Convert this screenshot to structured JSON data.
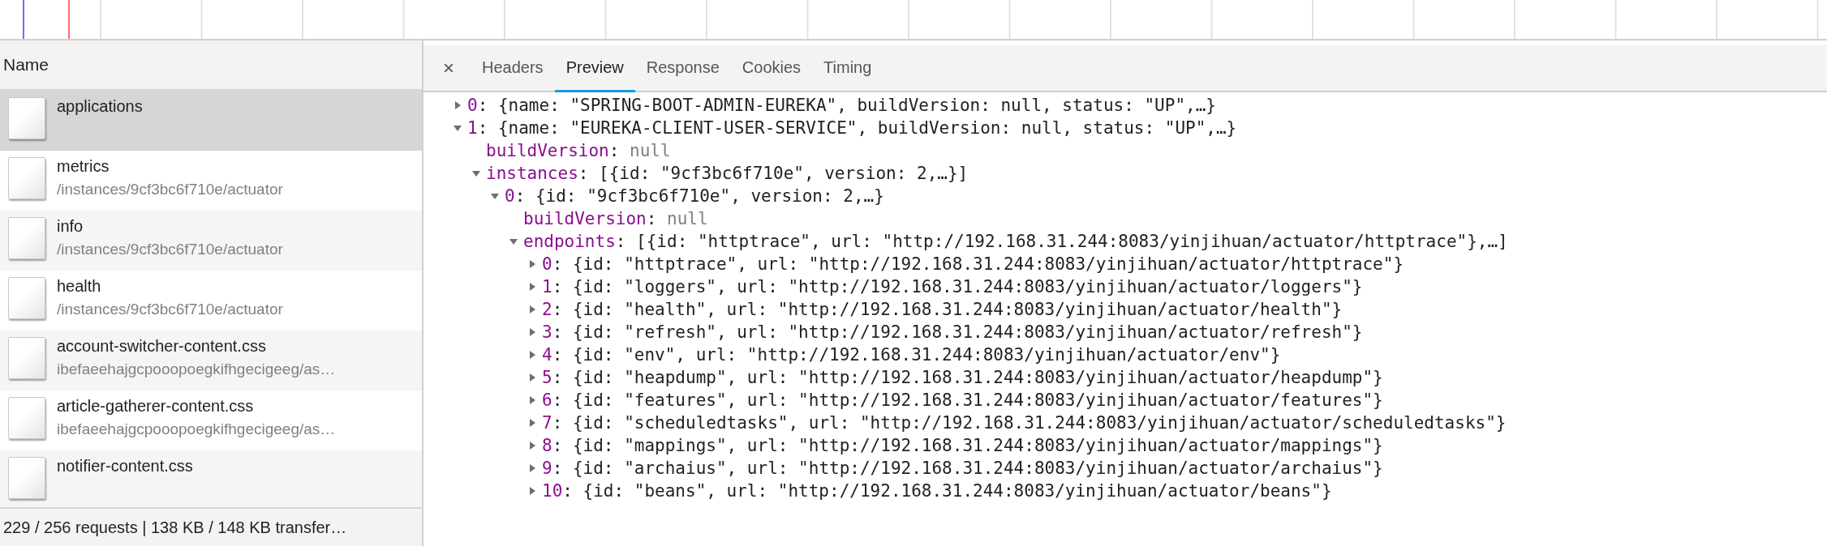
{
  "requests": {
    "column_header": "Name",
    "rows": [
      {
        "name": "applications",
        "selected": true
      },
      {
        "name": "metrics",
        "path": "/instances/9cf3bc6f710e/actuator",
        "selected": false
      },
      {
        "name": "info",
        "path": "/instances/9cf3bc6f710e/actuator",
        "selected": false
      },
      {
        "name": "health",
        "path": "/instances/9cf3bc6f710e/actuator",
        "selected": false
      },
      {
        "name": "account-switcher-content.css",
        "path": "ibefaeehajgcpooopoegkifhgecigeeg/as…",
        "selected": false
      },
      {
        "name": "article-gatherer-content.css",
        "path": "ibefaeehajgcpooopoegkifhgecigeeg/as…",
        "selected": false
      },
      {
        "name": "notifier-content.css",
        "selected": false
      }
    ],
    "status_bar": "229 / 256 requests | 138 KB / 148 KB transfer…"
  },
  "detail": {
    "close": "×",
    "tabs": [
      {
        "label": "Headers",
        "selected": false
      },
      {
        "label": "Preview",
        "selected": true
      },
      {
        "label": "Response",
        "selected": false
      },
      {
        "label": "Cookies",
        "selected": false
      },
      {
        "label": "Timing",
        "selected": false
      }
    ],
    "tree": [
      {
        "kind": "node",
        "key": "0",
        "text": ": {name: \"SPRING-BOOT-ADMIN-EUREKA\", buildVersion: null, status: \"UP\",…}",
        "expanded": false
      },
      {
        "kind": "node",
        "key": "1",
        "text": ": {name: \"EUREKA-CLIENT-USER-SERVICE\", buildVersion: null, status: \"UP\",…}",
        "expanded": true,
        "children": [
          {
            "kind": "null",
            "key": "buildVersion",
            "text": ": ",
            "value": "null"
          },
          {
            "kind": "node",
            "key": "instances",
            "text": ": [{id: \"9cf3bc6f710e\", version: 2,…}]",
            "expanded": true,
            "children": [
              {
                "kind": "node",
                "key": "0",
                "text": ": {id: \"9cf3bc6f710e\", version: 2,…}",
                "expanded": true,
                "children": [
                  {
                    "kind": "null",
                    "key": "buildVersion",
                    "text": ": ",
                    "value": "null"
                  },
                  {
                    "kind": "node",
                    "key": "endpoints",
                    "text": ": [{id: \"httptrace\", url: \"http://192.168.31.244:8083/yinjihuan/actuator/httptrace\"},…]",
                    "expanded": true,
                    "children": [
                      {
                        "kind": "node",
                        "key": "0",
                        "text": ": {id: \"httptrace\", url: \"http://192.168.31.244:8083/yinjihuan/actuator/httptrace\"}",
                        "expanded": false
                      },
                      {
                        "kind": "node",
                        "key": "1",
                        "text": ": {id: \"loggers\", url: \"http://192.168.31.244:8083/yinjihuan/actuator/loggers\"}",
                        "expanded": false
                      },
                      {
                        "kind": "node",
                        "key": "2",
                        "text": ": {id: \"health\", url: \"http://192.168.31.244:8083/yinjihuan/actuator/health\"}",
                        "expanded": false
                      },
                      {
                        "kind": "node",
                        "key": "3",
                        "text": ": {id: \"refresh\", url: \"http://192.168.31.244:8083/yinjihuan/actuator/refresh\"}",
                        "expanded": false
                      },
                      {
                        "kind": "node",
                        "key": "4",
                        "text": ": {id: \"env\", url: \"http://192.168.31.244:8083/yinjihuan/actuator/env\"}",
                        "expanded": false
                      },
                      {
                        "kind": "node",
                        "key": "5",
                        "text": ": {id: \"heapdump\", url: \"http://192.168.31.244:8083/yinjihuan/actuator/heapdump\"}",
                        "expanded": false
                      },
                      {
                        "kind": "node",
                        "key": "6",
                        "text": ": {id: \"features\", url: \"http://192.168.31.244:8083/yinjihuan/actuator/features\"}",
                        "expanded": false
                      },
                      {
                        "kind": "node",
                        "key": "7",
                        "text": ": {id: \"scheduledtasks\", url: \"http://192.168.31.244:8083/yinjihuan/actuator/scheduledtasks\"}",
                        "expanded": false
                      },
                      {
                        "kind": "node",
                        "key": "8",
                        "text": ": {id: \"mappings\", url: \"http://192.168.31.244:8083/yinjihuan/actuator/mappings\"}",
                        "expanded": false
                      },
                      {
                        "kind": "node",
                        "key": "9",
                        "text": ": {id: \"archaius\", url: \"http://192.168.31.244:8083/yinjihuan/actuator/archaius\"}",
                        "expanded": false
                      },
                      {
                        "kind": "node",
                        "key": "10",
                        "text": ": {id: \"beans\", url: \"http://192.168.31.244:8083/yinjihuan/actuator/beans\"}",
                        "expanded": false
                      }
                    ]
                  }
                ]
              }
            ]
          }
        ]
      }
    ]
  }
}
